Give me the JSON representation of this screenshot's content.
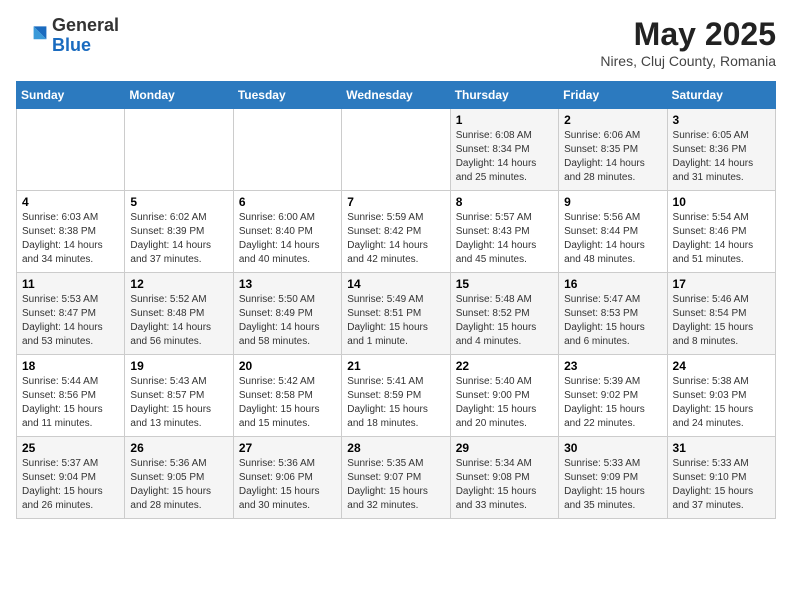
{
  "header": {
    "logo": {
      "general": "General",
      "blue": "Blue"
    },
    "title": "May 2025",
    "location": "Nires, Cluj County, Romania"
  },
  "days_of_week": [
    "Sunday",
    "Monday",
    "Tuesday",
    "Wednesday",
    "Thursday",
    "Friday",
    "Saturday"
  ],
  "weeks": [
    [
      {
        "day": "",
        "info": ""
      },
      {
        "day": "",
        "info": ""
      },
      {
        "day": "",
        "info": ""
      },
      {
        "day": "",
        "info": ""
      },
      {
        "day": "1",
        "info": "Sunrise: 6:08 AM\nSunset: 8:34 PM\nDaylight: 14 hours\nand 25 minutes."
      },
      {
        "day": "2",
        "info": "Sunrise: 6:06 AM\nSunset: 8:35 PM\nDaylight: 14 hours\nand 28 minutes."
      },
      {
        "day": "3",
        "info": "Sunrise: 6:05 AM\nSunset: 8:36 PM\nDaylight: 14 hours\nand 31 minutes."
      }
    ],
    [
      {
        "day": "4",
        "info": "Sunrise: 6:03 AM\nSunset: 8:38 PM\nDaylight: 14 hours\nand 34 minutes."
      },
      {
        "day": "5",
        "info": "Sunrise: 6:02 AM\nSunset: 8:39 PM\nDaylight: 14 hours\nand 37 minutes."
      },
      {
        "day": "6",
        "info": "Sunrise: 6:00 AM\nSunset: 8:40 PM\nDaylight: 14 hours\nand 40 minutes."
      },
      {
        "day": "7",
        "info": "Sunrise: 5:59 AM\nSunset: 8:42 PM\nDaylight: 14 hours\nand 42 minutes."
      },
      {
        "day": "8",
        "info": "Sunrise: 5:57 AM\nSunset: 8:43 PM\nDaylight: 14 hours\nand 45 minutes."
      },
      {
        "day": "9",
        "info": "Sunrise: 5:56 AM\nSunset: 8:44 PM\nDaylight: 14 hours\nand 48 minutes."
      },
      {
        "day": "10",
        "info": "Sunrise: 5:54 AM\nSunset: 8:46 PM\nDaylight: 14 hours\nand 51 minutes."
      }
    ],
    [
      {
        "day": "11",
        "info": "Sunrise: 5:53 AM\nSunset: 8:47 PM\nDaylight: 14 hours\nand 53 minutes."
      },
      {
        "day": "12",
        "info": "Sunrise: 5:52 AM\nSunset: 8:48 PM\nDaylight: 14 hours\nand 56 minutes."
      },
      {
        "day": "13",
        "info": "Sunrise: 5:50 AM\nSunset: 8:49 PM\nDaylight: 14 hours\nand 58 minutes."
      },
      {
        "day": "14",
        "info": "Sunrise: 5:49 AM\nSunset: 8:51 PM\nDaylight: 15 hours\nand 1 minute."
      },
      {
        "day": "15",
        "info": "Sunrise: 5:48 AM\nSunset: 8:52 PM\nDaylight: 15 hours\nand 4 minutes."
      },
      {
        "day": "16",
        "info": "Sunrise: 5:47 AM\nSunset: 8:53 PM\nDaylight: 15 hours\nand 6 minutes."
      },
      {
        "day": "17",
        "info": "Sunrise: 5:46 AM\nSunset: 8:54 PM\nDaylight: 15 hours\nand 8 minutes."
      }
    ],
    [
      {
        "day": "18",
        "info": "Sunrise: 5:44 AM\nSunset: 8:56 PM\nDaylight: 15 hours\nand 11 minutes."
      },
      {
        "day": "19",
        "info": "Sunrise: 5:43 AM\nSunset: 8:57 PM\nDaylight: 15 hours\nand 13 minutes."
      },
      {
        "day": "20",
        "info": "Sunrise: 5:42 AM\nSunset: 8:58 PM\nDaylight: 15 hours\nand 15 minutes."
      },
      {
        "day": "21",
        "info": "Sunrise: 5:41 AM\nSunset: 8:59 PM\nDaylight: 15 hours\nand 18 minutes."
      },
      {
        "day": "22",
        "info": "Sunrise: 5:40 AM\nSunset: 9:00 PM\nDaylight: 15 hours\nand 20 minutes."
      },
      {
        "day": "23",
        "info": "Sunrise: 5:39 AM\nSunset: 9:02 PM\nDaylight: 15 hours\nand 22 minutes."
      },
      {
        "day": "24",
        "info": "Sunrise: 5:38 AM\nSunset: 9:03 PM\nDaylight: 15 hours\nand 24 minutes."
      }
    ],
    [
      {
        "day": "25",
        "info": "Sunrise: 5:37 AM\nSunset: 9:04 PM\nDaylight: 15 hours\nand 26 minutes."
      },
      {
        "day": "26",
        "info": "Sunrise: 5:36 AM\nSunset: 9:05 PM\nDaylight: 15 hours\nand 28 minutes."
      },
      {
        "day": "27",
        "info": "Sunrise: 5:36 AM\nSunset: 9:06 PM\nDaylight: 15 hours\nand 30 minutes."
      },
      {
        "day": "28",
        "info": "Sunrise: 5:35 AM\nSunset: 9:07 PM\nDaylight: 15 hours\nand 32 minutes."
      },
      {
        "day": "29",
        "info": "Sunrise: 5:34 AM\nSunset: 9:08 PM\nDaylight: 15 hours\nand 33 minutes."
      },
      {
        "day": "30",
        "info": "Sunrise: 5:33 AM\nSunset: 9:09 PM\nDaylight: 15 hours\nand 35 minutes."
      },
      {
        "day": "31",
        "info": "Sunrise: 5:33 AM\nSunset: 9:10 PM\nDaylight: 15 hours\nand 37 minutes."
      }
    ]
  ]
}
